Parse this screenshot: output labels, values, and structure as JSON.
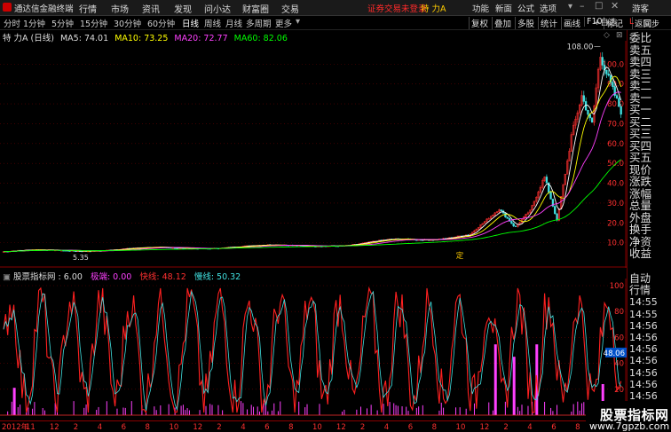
{
  "menubar": {
    "app_title": "通达信金融终端",
    "items": [
      "行情",
      "市场",
      "资讯",
      "发现",
      "问小达",
      "财富圈",
      "交易"
    ],
    "warning": "证券交易未登录",
    "stock_name": "特 力A",
    "right_items": [
      "功能",
      "新面",
      "公式",
      "选项",
      "游客"
    ]
  },
  "periods": [
    "分时",
    "1分钟",
    "5分钟",
    "15分钟",
    "30分钟",
    "60分钟",
    "日线",
    "周线",
    "月线",
    "多周期",
    "更多"
  ],
  "tools": [
    "复权",
    "叠加",
    "多股",
    "统计",
    "画线",
    "F10",
    "标记",
    "返回"
  ],
  "main_chart": {
    "title": "特 力A (日线)",
    "ma5": "MA5: 74.01",
    "ma10": "MA10: 73.25",
    "ma20": "MA20: 72.77",
    "ma60": "MA60: 82.06",
    "high_label": "108.00",
    "low_label": "5.35",
    "marker": "定",
    "y_ticks": [
      "100.0",
      "90.0",
      "80.0",
      "70.0",
      "60.0",
      "50.0",
      "40.0",
      "30.0",
      "20.0",
      "10.0"
    ]
  },
  "indicator": {
    "title": "股票指标网 : 6.00",
    "line1": "极端: 0.00",
    "line2": "快线: 48.12",
    "line3": "慢线: 50.32",
    "y_ticks": [
      "100",
      "80",
      "60",
      "40",
      "20"
    ],
    "current_value": "48.06"
  },
  "x_axis": {
    "labels": [
      "2012年",
      "11",
      "12",
      "2",
      "4",
      "6",
      "8",
      "10",
      "12",
      "2",
      "4",
      "6",
      "8",
      "10",
      "12",
      "2",
      "4",
      "6",
      "8",
      "10",
      "12",
      "2",
      "4",
      "6",
      "8",
      "11"
    ]
  },
  "right_panel": {
    "top_labels": [
      "L",
      "同步",
      "+自选"
    ],
    "items": [
      "委比",
      "卖五",
      "卖四",
      "卖三",
      "卖二",
      "卖一",
      "买一",
      "买二",
      "买三",
      "买四",
      "买五",
      "现价",
      "涨跌",
      "涨幅",
      "总量",
      "外盘",
      "换手",
      "净资",
      "收益"
    ],
    "bottom_items": [
      "自动",
      "行情",
      "14:55",
      "14:55",
      "14:56",
      "14:56",
      "14:56",
      "14:56",
      "14:56",
      "14:56",
      "14:56",
      "14:56"
    ]
  },
  "watermark": {
    "title": "股票指标网",
    "url": "www.7gpzb.com"
  },
  "colors": {
    "candle_up": "#ff3030",
    "candle_down": "#40e0e0",
    "ma5": "#ffffff",
    "ma10": "#ffff00",
    "ma20": "#ff40ff",
    "ma60": "#00ff00",
    "grid": "#660000"
  }
}
